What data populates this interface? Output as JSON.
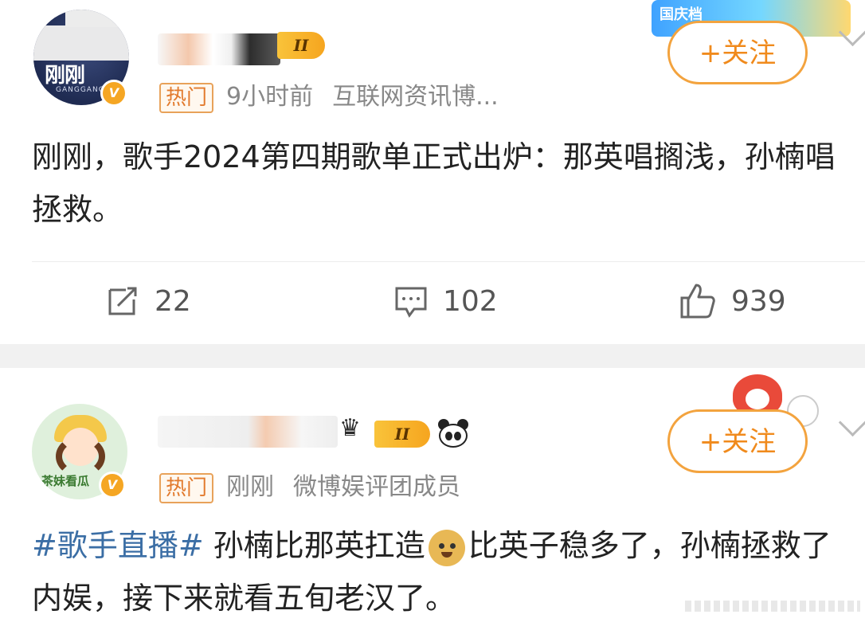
{
  "posts": [
    {
      "author_badge_level": "II",
      "hot_tag": "热门",
      "time": "9小时前",
      "source": "互联网资讯博...",
      "avatar_text": "刚刚",
      "avatar_subtext": "GANGGANG",
      "follow_label": "+关注",
      "content": "刚刚，歌手2024第四期歌单正式出炉：那英唱搁浅，孙楠唱拯救。",
      "actions": {
        "repost_count": "22",
        "comment_count": "102",
        "like_count": "939"
      },
      "banner_text": "国庆档"
    },
    {
      "author_badge_level": "II",
      "hot_tag": "热门",
      "time": "刚刚",
      "source": "微博娱评团成员",
      "avatar_text": "茶妹看瓜",
      "follow_label": "+关注",
      "content_hashtag": "#歌手直播#",
      "content_part1": " 孙楠比那英扛造",
      "content_part2": "比英子稳多了，孙楠拯救了内娱，接下来就看五旬老汉了。"
    }
  ],
  "colors": {
    "accent": "#f08a1c",
    "hashtag": "#3b6ea5",
    "verified": "#f5a623",
    "separator": "#f1f1f1"
  },
  "icons": [
    "repost-icon",
    "comment-icon",
    "like-icon",
    "crown-icon",
    "panda-icon",
    "doge-emoji-icon",
    "chevron-down-icon",
    "verified-icon"
  ]
}
